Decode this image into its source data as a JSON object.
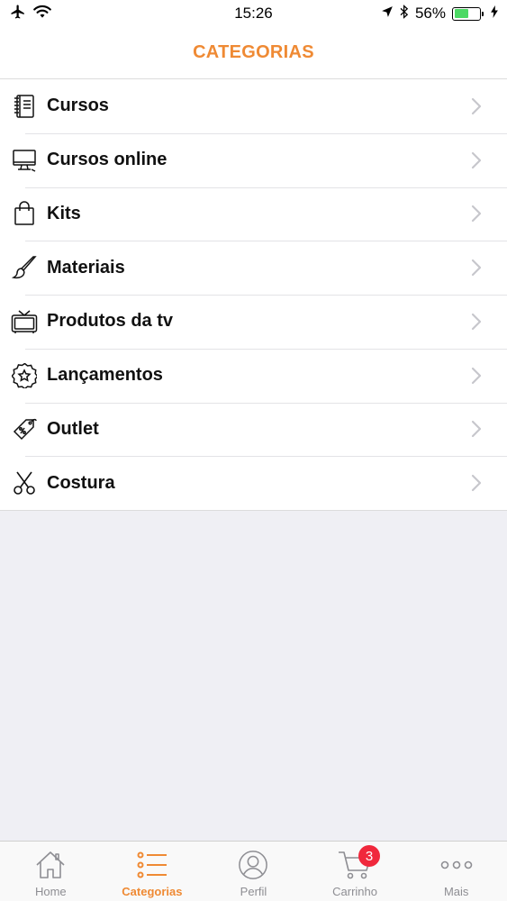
{
  "status_bar": {
    "time": "15:26",
    "battery_percent": "56%",
    "battery_level": 0.56,
    "icons": [
      "airplane-icon",
      "wifi-icon",
      "location-arrow-icon",
      "bluetooth-icon",
      "battery-icon",
      "charging-bolt-icon"
    ]
  },
  "header": {
    "title": "CATEGORIAS"
  },
  "categories": [
    {
      "label": "Cursos",
      "icon": "notebook-icon"
    },
    {
      "label": "Cursos online",
      "icon": "monitor-icon"
    },
    {
      "label": "Kits",
      "icon": "shopping-bag-icon"
    },
    {
      "label": "Materiais",
      "icon": "paintbrush-icon"
    },
    {
      "label": "Produtos da tv",
      "icon": "tv-icon"
    },
    {
      "label": "Lançamentos",
      "icon": "star-badge-icon"
    },
    {
      "label": "Outlet",
      "icon": "price-tag-icon"
    },
    {
      "label": "Costura",
      "icon": "scissors-icon"
    }
  ],
  "tab_bar": {
    "tabs": [
      {
        "label": "Home",
        "icon": "home-icon",
        "active": false
      },
      {
        "label": "Categorias",
        "icon": "list-icon",
        "active": true
      },
      {
        "label": "Perfil",
        "icon": "profile-icon",
        "active": false
      },
      {
        "label": "Carrinho",
        "icon": "cart-icon",
        "active": false,
        "badge": "3"
      },
      {
        "label": "Mais",
        "icon": "more-icon",
        "active": false
      }
    ]
  },
  "colors": {
    "accent": "#ef8a34",
    "badge": "#f0283c",
    "battery": "#4cd964",
    "background": "#efeff4"
  }
}
